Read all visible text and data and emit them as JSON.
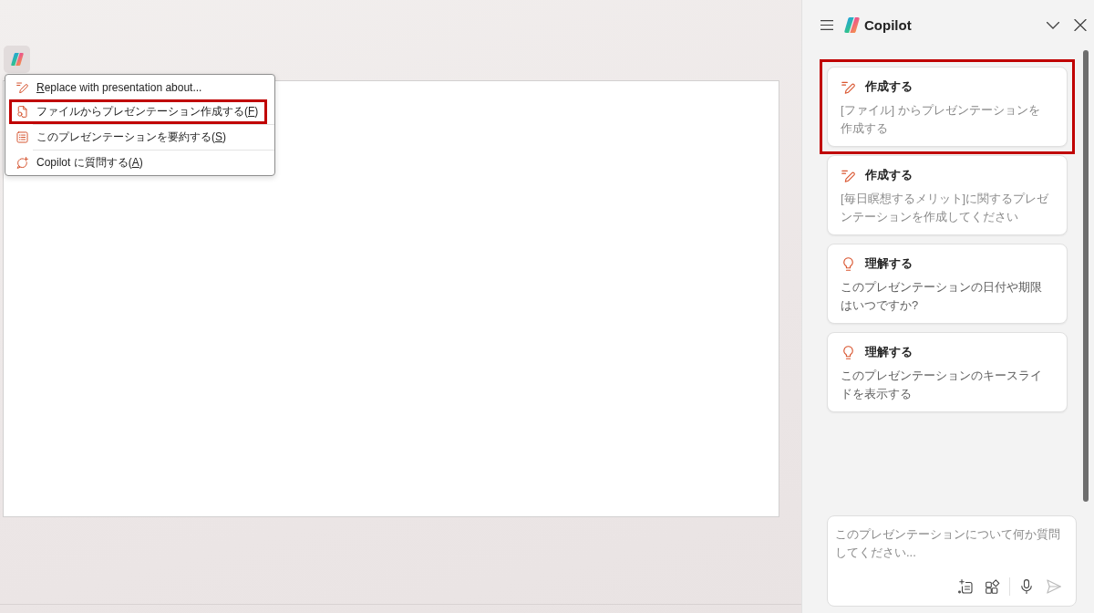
{
  "context_menu": {
    "groups": [
      [
        {
          "kind": "edit",
          "highlighted": false,
          "access_key": "R",
          "text_after": "eplace with presentation about..."
        },
        {
          "kind": "file",
          "highlighted": true,
          "text_before": "ファイルからプレゼンテーション作成する(",
          "access_key": "F",
          "text_after": ")"
        }
      ],
      [
        {
          "kind": "summary",
          "highlighted": false,
          "text_before": "このプレゼンテーションを要約する(",
          "access_key": "S",
          "text_after": ")"
        }
      ],
      [
        {
          "kind": "ask",
          "highlighted": false,
          "text_before": "Copilot に質問する(",
          "access_key": "A",
          "text_after": ")"
        }
      ]
    ]
  },
  "copilot_panel": {
    "title": "Copilot",
    "cards": [
      {
        "kind": "create",
        "title": "作成する",
        "text": "[ファイル] からプレゼンテーションを作成する",
        "highlighted": true
      },
      {
        "kind": "create",
        "title": "作成する",
        "text": "[毎日瞑想するメリット]に関するプレゼンテーションを作成してください",
        "highlighted": false
      },
      {
        "kind": "understand",
        "title": "理解する",
        "text": "このプレゼンテーションの日付や期限はいつですか?",
        "highlighted": false
      },
      {
        "kind": "understand",
        "title": "理解する",
        "text": "このプレゼンテーションのキースライドを表示する",
        "highlighted": false
      }
    ],
    "composer": {
      "placeholder": "このプレゼンテーションについて何か質問してください...",
      "send_enabled": false
    }
  }
}
